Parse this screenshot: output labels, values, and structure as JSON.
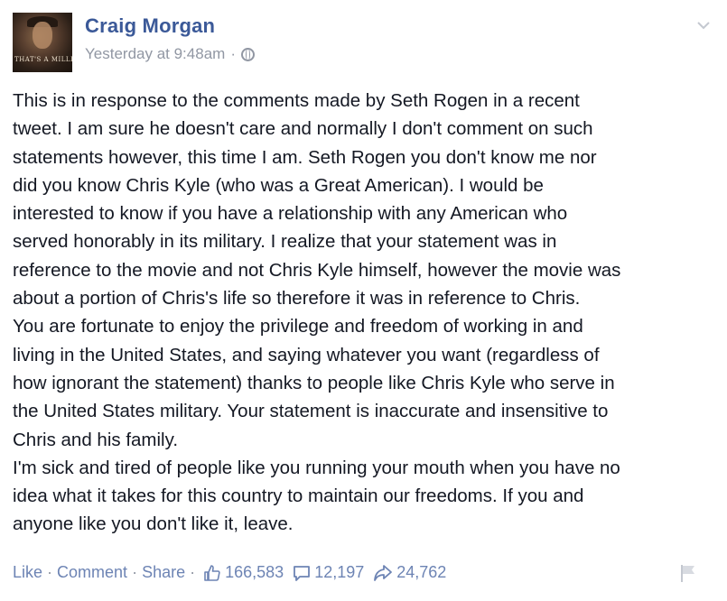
{
  "post": {
    "author": "Craig Morgan",
    "timestamp": "Yesterday at 9:48am",
    "meta_separator": "·",
    "avatar_caption": "THAT'S A MILLION",
    "body_lines": [
      "This is in response to the comments made by Seth Rogen in a recent",
      "tweet. I am sure he doesn't care and normally I don't comment on such",
      "statements however, this time I am. Seth Rogen you don't know me nor",
      "did you know Chris Kyle (who was a Great American). I would be",
      "interested to know if you have a relationship with any American who",
      "served honorably in its military. I realize that your statement was in",
      "reference to the movie and not Chris Kyle himself, however the movie was",
      "about a portion of Chris's life so therefore it was in reference to Chris.",
      "You are fortunate to enjoy the privilege and freedom of working in and",
      "living in the United States, and saying whatever you want (regardless of",
      "how ignorant the statement) thanks to people like Chris Kyle who serve in",
      "the United States military. Your statement is inaccurate and insensitive to",
      "Chris and his family.",
      "I'm sick and tired of people like you running your mouth when you have no",
      "idea what it takes for this country to maintain our freedoms. If you and",
      "anyone like you don't like it, leave."
    ]
  },
  "actions": {
    "like_label": "Like",
    "comment_label": "Comment",
    "share_label": "Share",
    "separator": "·",
    "likes_count": "166,583",
    "comments_count": "12,197",
    "shares_count": "24,762"
  },
  "icons": {
    "timestamp_privacy": "globe-icon",
    "post_menu": "chevron-down-icon",
    "likes": "thumbs-up-icon",
    "comments": "comment-bubble-icon",
    "shares": "share-arrow-icon",
    "report": "flag-icon"
  },
  "colors": {
    "author_link": "#3b5998",
    "action_link": "#6d84b4",
    "muted_text": "#9197a3",
    "body_text": "#141823"
  }
}
